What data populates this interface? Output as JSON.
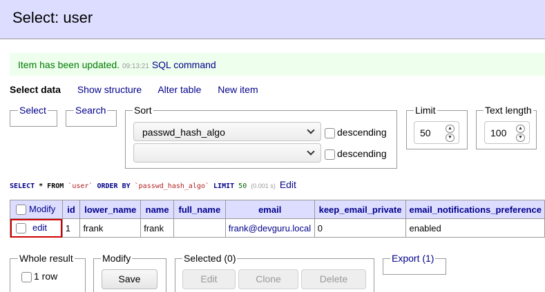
{
  "header": {
    "title": "Select: user"
  },
  "message": {
    "text": "Item has been updated.",
    "time": "09:13:21",
    "link": "SQL command"
  },
  "links": {
    "current": "Select data",
    "items": [
      "Show structure",
      "Alter table",
      "New item"
    ]
  },
  "filters": {
    "select_legend": "Select",
    "search_legend": "Search",
    "sort_legend": "Sort",
    "sort_rows": [
      {
        "value": "passwd_hash_algo",
        "desc_label": "descending"
      },
      {
        "value": "",
        "desc_label": "descending"
      }
    ],
    "limit_legend": "Limit",
    "limit_value": "50",
    "text_length_legend": "Text length",
    "text_length_value": "100"
  },
  "sql": {
    "select": "SELECT",
    "star_from": " * FROM ",
    "table": "`user`",
    "order_by": " ORDER BY ",
    "column": "`passwd_hash_algo`",
    "limit": " LIMIT ",
    "limit_num": "50",
    "time": "(0.001 s)",
    "edit": "Edit"
  },
  "table": {
    "modify_header": "Modify",
    "columns": [
      "id",
      "lower_name",
      "name",
      "full_name",
      "email",
      "keep_email_private",
      "email_notifications_preference"
    ],
    "rows": [
      {
        "edit": "edit",
        "cells": [
          "1",
          "frank",
          "frank",
          "",
          "frank@devguru.local",
          "0",
          "enabled"
        ]
      }
    ]
  },
  "actions": {
    "whole_result_legend": "Whole result",
    "row_count": "1 row",
    "modify_legend": "Modify",
    "save": "Save",
    "selected_legend": "Selected (0)",
    "edit": "Edit",
    "clone": "Clone",
    "delete": "Delete",
    "export_legend": "Export (1)"
  },
  "colors": {
    "header_bg": "#ddddff",
    "message_bg": "#eeffee",
    "message_text": "#007a00",
    "link": "#00008b",
    "highlight": "#d00000"
  }
}
